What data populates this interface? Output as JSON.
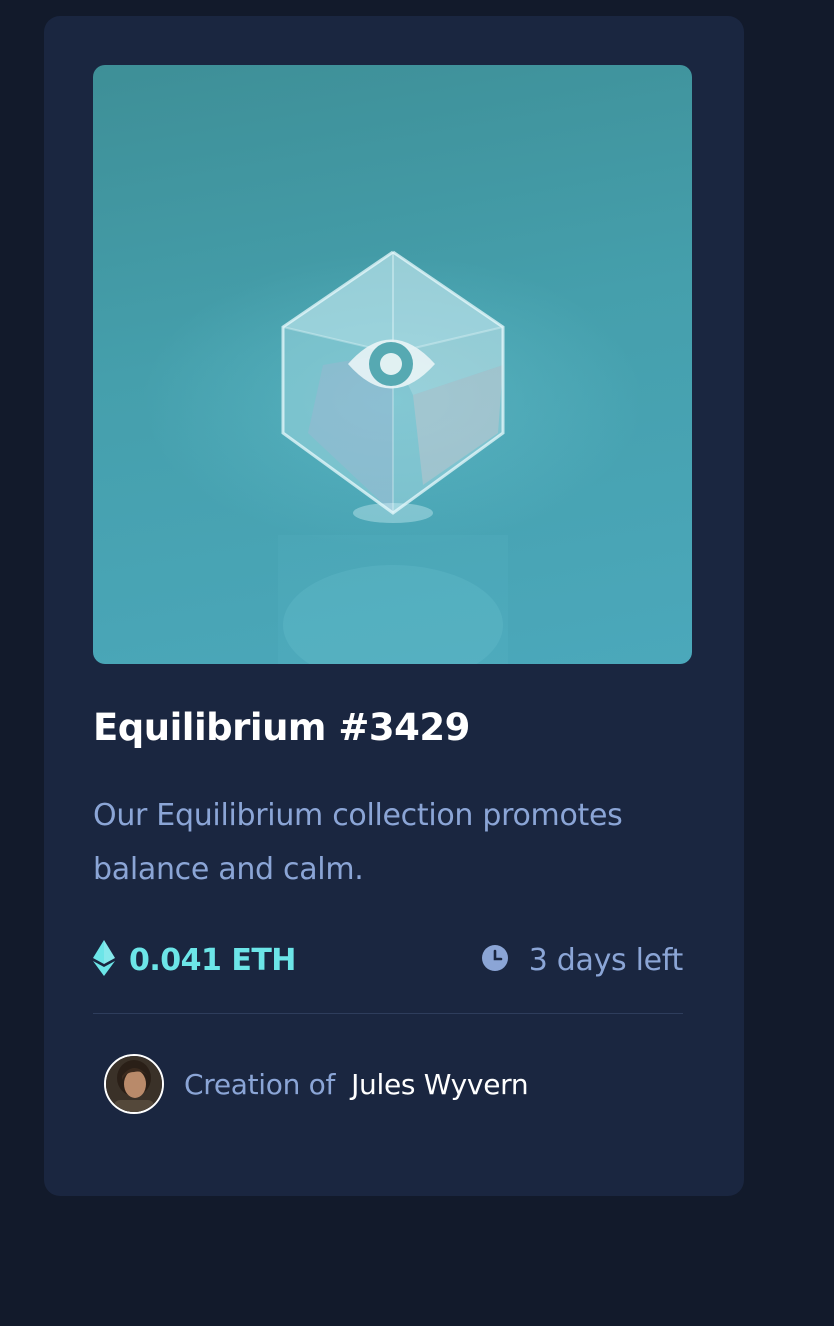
{
  "card": {
    "title": "Equilibrium #3429",
    "description": "Our Equilibrium collection promotes balance and calm.",
    "price": "0.041 ETH",
    "time_left": "3 days left",
    "creator_prefix": "Creation of",
    "creator_name": "Jules Wyvern",
    "hero_overlay_icon": "eye-icon",
    "price_icon": "ethereum-icon",
    "time_icon": "clock-icon"
  },
  "colors": {
    "page_bg": "#121a2b",
    "card_bg": "#1a2640",
    "accent_cyan": "#6ce5e8",
    "soft_blue": "#8ba5d6",
    "white": "#ffffff",
    "divider": "#2e3d5c"
  }
}
